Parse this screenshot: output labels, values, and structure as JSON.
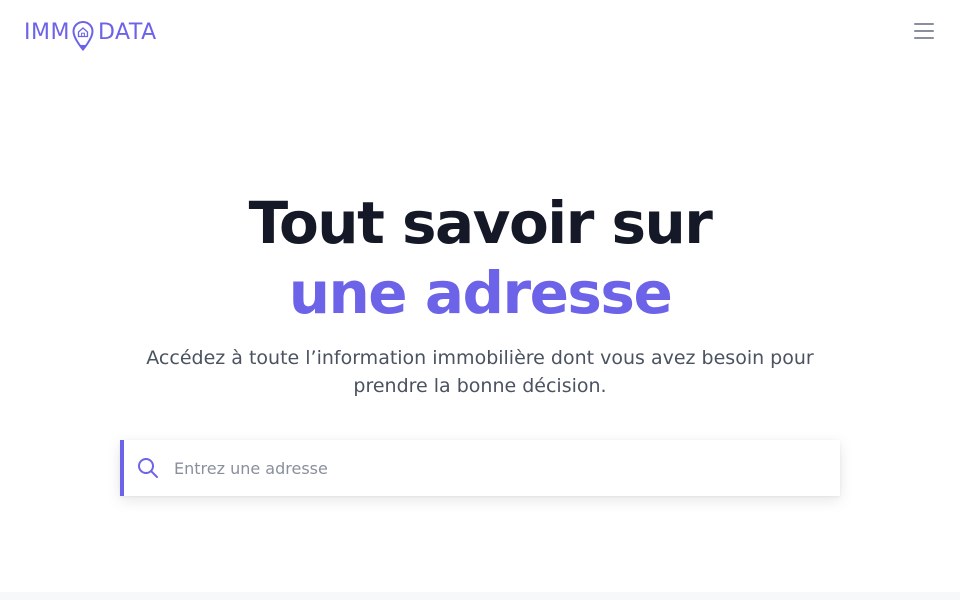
{
  "header": {
    "logo": {
      "left_text": "IMM",
      "right_text": "DATA",
      "icon": "location-pin-house-icon",
      "color": "#6c63e8"
    },
    "menu_icon": "hamburger-menu-icon"
  },
  "hero": {
    "title_line1": "Tout savoir sur",
    "title_line2": "une adresse",
    "title_color": "#151826",
    "accent_color": "#6c63e8",
    "subtitle_line1": "Accédez à toute l’information immobilière dont vous avez besoin pour",
    "subtitle_line2": "prendre la bonne décision."
  },
  "search": {
    "placeholder": "Entrez une adresse",
    "value": "",
    "icon": "search-icon"
  }
}
